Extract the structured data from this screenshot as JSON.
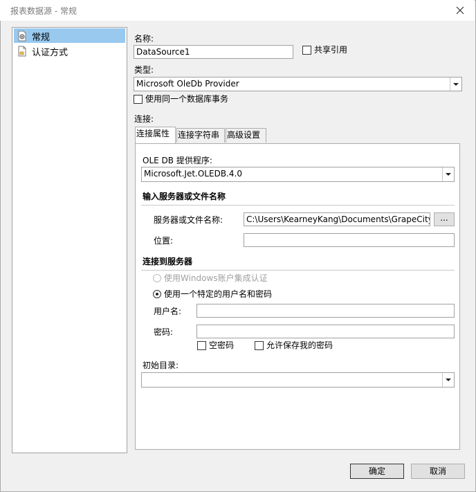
{
  "window": {
    "title": "报表数据源 - 常规"
  },
  "nav": {
    "items": [
      {
        "label": "常规",
        "icon": "gear-document-icon",
        "selected": true
      },
      {
        "label": "认证方式",
        "icon": "document-icon",
        "selected": false
      }
    ]
  },
  "general": {
    "name_label": "名称:",
    "name_value": "DataSource1",
    "shared_ref_label": "共享引用",
    "type_label": "类型:",
    "type_value": "Microsoft OleDb Provider",
    "same_transaction_label": "使用同一个数据库事务",
    "connection_label": "连接:"
  },
  "tabs": [
    {
      "label": "连接属性",
      "active": true
    },
    {
      "label": "连接字符串",
      "active": false
    },
    {
      "label": "高级设置",
      "active": false
    }
  ],
  "connection": {
    "provider_label": "OLE DB 提供程序:",
    "provider_value": "Microsoft.Jet.OLEDB.4.0",
    "server_section": "输入服务器或文件名称",
    "server_label": "服务器或文件名称:",
    "server_value": "C:\\Users\\KearneyKang\\Documents\\GrapeCity Sa",
    "browse_label": "...",
    "location_label": "位置:",
    "location_value": "",
    "connect_section": "连接到服务器",
    "windows_auth_label": "使用Windows账户集成认证",
    "specific_auth_label": "使用一个特定的用户名和密码",
    "username_label": "用户名:",
    "username_value": "",
    "password_label": "密码:",
    "password_value": "",
    "empty_password_label": "空密码",
    "save_password_label": "允许保存我的密码",
    "initial_catalog_label": "初始目录:",
    "initial_catalog_value": ""
  },
  "footer": {
    "ok_label": "确定",
    "cancel_label": "取消"
  },
  "colors": {
    "selection": "#99c9ef",
    "border": "#a0a0a0",
    "background": "#f0f0f0"
  }
}
